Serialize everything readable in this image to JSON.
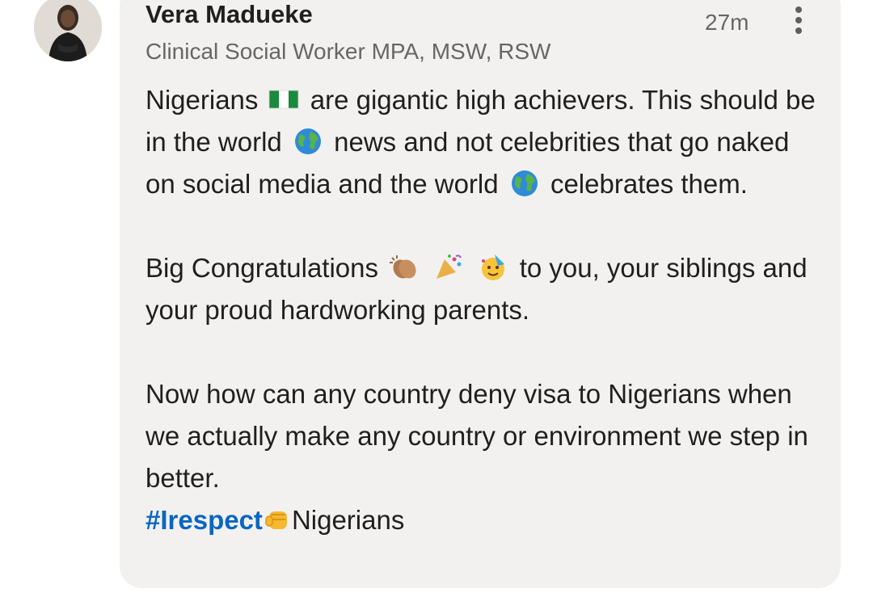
{
  "comment": {
    "author_name": "Vera Madueke",
    "author_headline": "Clinical Social Worker MPA, MSW, RSW",
    "timestamp": "27m",
    "paragraph1": {
      "part1": "Nigerians",
      "part2": "are gigantic high achievers. This should be in the world",
      "part3": "news and not celebrities that go naked on social media and the world",
      "part4": "celebrates them."
    },
    "paragraph2": {
      "part1": "Big Congratulations",
      "part2": "to you, your siblings and your proud hardworking parents."
    },
    "paragraph3": "Now how can any country deny visa to Nigerians when we actually make any country or environment we step in better.",
    "hashtag": "#Irespect",
    "hashtag_tail": "Nigerians",
    "icons": [
      "nigeria-flag-icon",
      "globe-icon",
      "clapping-hands-icon",
      "party-popper-icon",
      "partying-face-icon",
      "raised-fist-icon",
      "more-options-icon"
    ]
  },
  "colors": {
    "bubble_background": "#f2f1ef",
    "link": "#0a66c2",
    "text": "#1f1f1f",
    "secondary_text": "#666666"
  }
}
